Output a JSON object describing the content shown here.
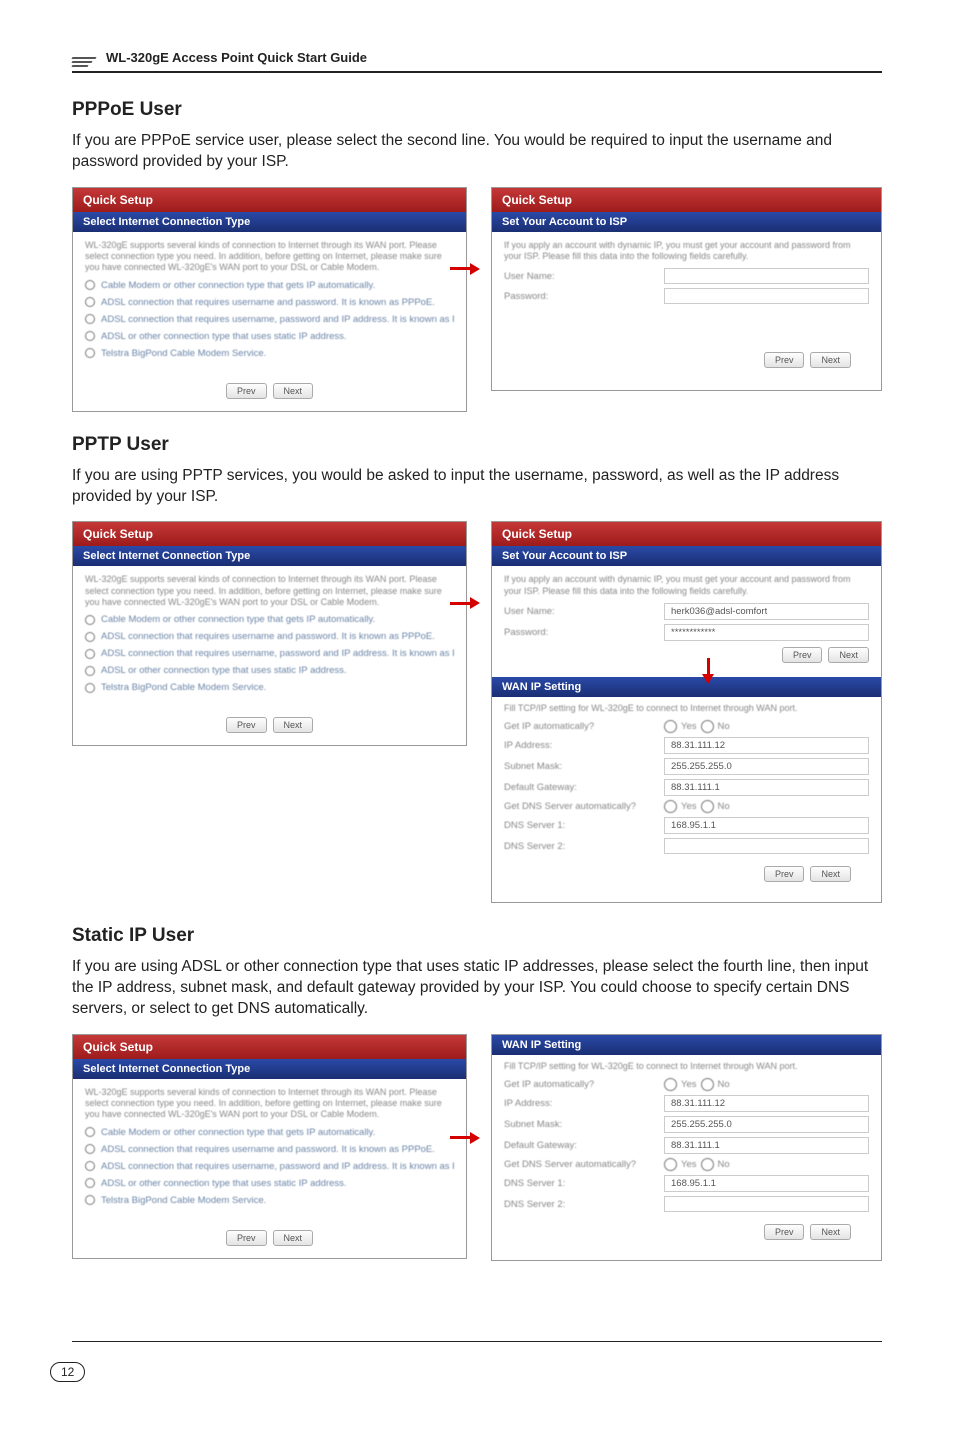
{
  "header": {
    "guide_title": "WL-320gE Access Point Quick Start Guide"
  },
  "page_number": "12",
  "sections": {
    "pppoe": {
      "title": "PPPoE User",
      "body": "If you are PPPoE service user, please select the second line. You would be required to input the username and password provided by your ISP."
    },
    "pptp": {
      "title": "PPTP User",
      "body": "If you are using PPTP services, you would be asked to input the username, password, as well as the IP address provided by your ISP."
    },
    "static": {
      "title": "Static IP User",
      "body": "If you are using ADSL or other connection type that uses static IP addresses, please select the fourth line, then input the IP address, subnet mask, and default gateway provided by your ISP. You could choose to specify certain DNS servers, or select to get DNS automatically."
    }
  },
  "ui": {
    "quick_setup": "Quick Setup",
    "select_conn": "Select Internet Connection Type",
    "conn_descr": "WL-320gE supports several kinds of connection to Internet through its WAN port. Please select connection type you need. In addition, before getting on Internet, please make sure you have connected WL-320gE's WAN port to your DSL or Cable Modem.",
    "opts": [
      "Cable Modem or other connection type that gets IP automatically.",
      "ADSL connection that requires username and password. It is known as PPPoE.",
      "ADSL connection that requires username, password and IP address. It is known as PPTP.",
      "ADSL or other connection type that uses static IP address.",
      "Telstra BigPond Cable Modem Service."
    ],
    "prev_btn": "Prev",
    "next_btn": "Next",
    "set_account": "Set Your Account to ISP",
    "account_descr": "If you apply an account with dynamic IP, you must get your account and password from your ISP. Please fill this data into the following fields carefully.",
    "user_name_lbl": "User Name:",
    "password_lbl": "Password:",
    "wan_ip_setting": "WAN IP Setting",
    "wan_descr": "Fill TCP/IP setting for WL-320gE to connect to Internet through WAN port.",
    "get_ip_auto": "Get IP automatically?",
    "ip_address": "IP Address:",
    "subnet_mask": "Subnet Mask:",
    "default_gw": "Default Gateway:",
    "get_dns_auto": "Get DNS Server automatically?",
    "dns1": "DNS Server 1:",
    "dns2": "DNS Server 2:",
    "yes": "Yes",
    "no": "No",
    "pptp_user": "herk036@adsl-comfort",
    "pptp_pass": "************",
    "ip_val": "88.31.111.12",
    "mask_val": "255.255.255.0",
    "gw_val": "88.31.111.1",
    "dns1_val": "168.95.1.1"
  }
}
